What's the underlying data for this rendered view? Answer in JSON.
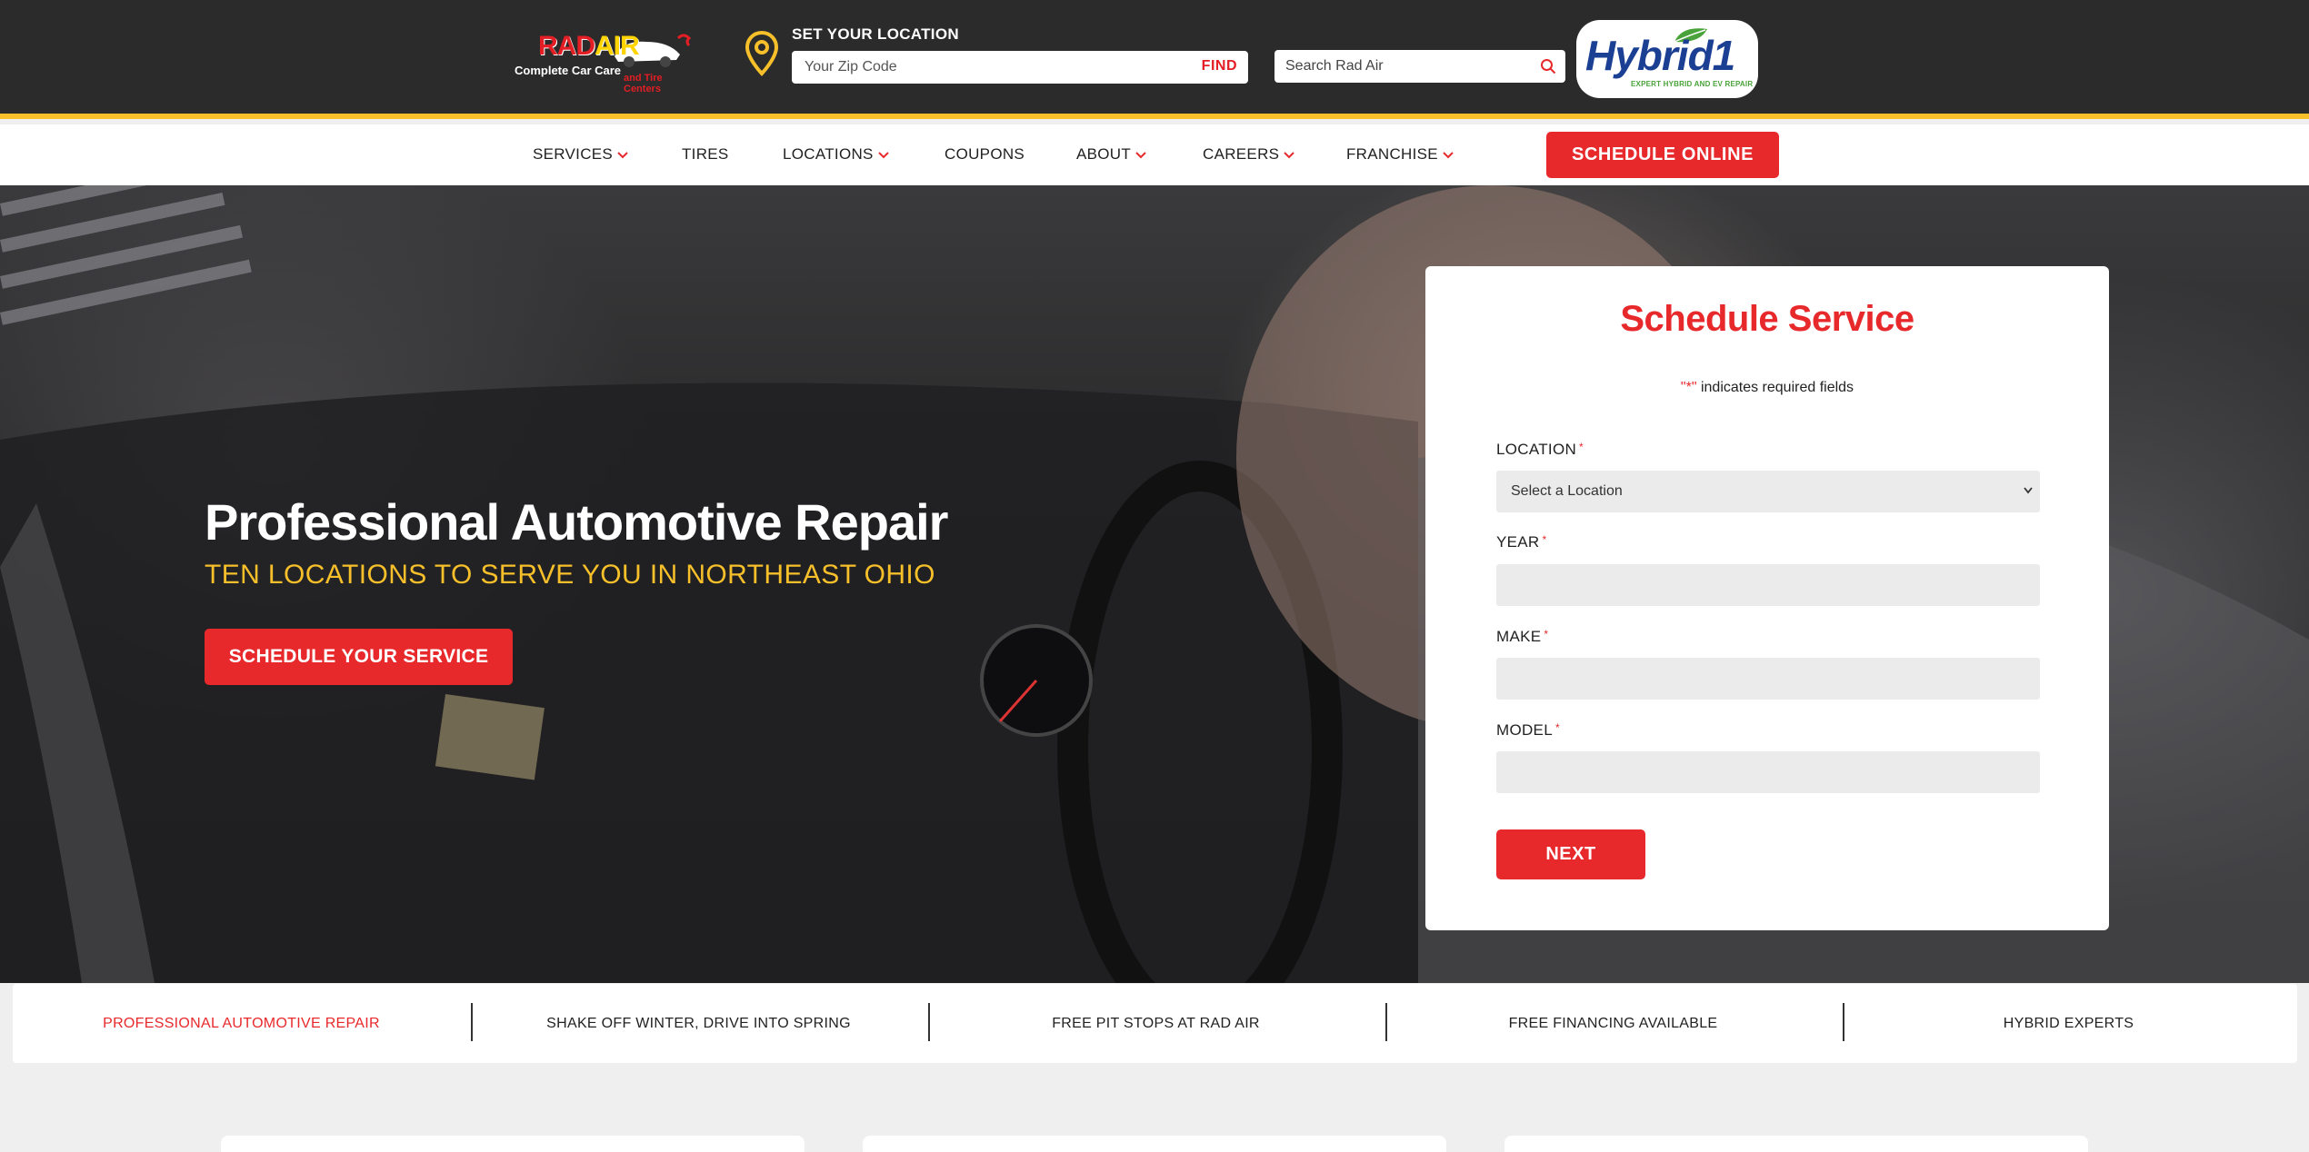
{
  "header": {
    "logo": {
      "brand_rad": "RAD",
      "brand_air": "AIR",
      "tagline_1": "Complete Car Care",
      "tagline_2": "and Tire Centers"
    },
    "location": {
      "label": "SET YOUR LOCATION",
      "zip_placeholder": "Your Zip Code",
      "find_label": "FIND",
      "icon": "map-pin-icon"
    },
    "search": {
      "placeholder": "Search Rad Air",
      "icon": "search-icon"
    },
    "hybrid_badge": {
      "title": "Hybrid1",
      "subtitle": "EXPERT HYBRID AND EV REPAIR"
    }
  },
  "nav": {
    "items": [
      {
        "label": "SERVICES",
        "dropdown": true
      },
      {
        "label": "TIRES",
        "dropdown": false
      },
      {
        "label": "LOCATIONS",
        "dropdown": true
      },
      {
        "label": "COUPONS",
        "dropdown": false
      },
      {
        "label": "ABOUT",
        "dropdown": true
      },
      {
        "label": "CAREERS",
        "dropdown": true
      },
      {
        "label": "FRANCHISE",
        "dropdown": true
      }
    ],
    "cta_label": "SCHEDULE ONLINE"
  },
  "hero": {
    "title": "Professional Automotive Repair",
    "subtitle": "TEN LOCATIONS TO SERVE YOU IN NORTHEAST OHIO",
    "button_label": "SCHEDULE YOUR SERVICE"
  },
  "schedule_form": {
    "title": "Schedule Service",
    "required_note_mark": "\"*\"",
    "required_note_text": " indicates required fields",
    "fields": {
      "location": {
        "label": "LOCATION",
        "required_mark": "*",
        "selected": "Select a Location"
      },
      "year": {
        "label": "YEAR",
        "required_mark": "*",
        "value": ""
      },
      "make": {
        "label": "MAKE",
        "required_mark": "*",
        "value": ""
      },
      "model": {
        "label": "MODEL",
        "required_mark": "*",
        "value": ""
      }
    },
    "next_label": "NEXT"
  },
  "ticker": {
    "items": [
      {
        "label": "PROFESSIONAL AUTOMOTIVE REPAIR",
        "active": true
      },
      {
        "label": "SHAKE OFF WINTER, DRIVE INTO SPRING",
        "active": false
      },
      {
        "label": "FREE PIT STOPS AT RAD AIR",
        "active": false
      },
      {
        "label": "FREE FINANCING AVAILABLE",
        "active": false
      },
      {
        "label": "HYBRID EXPERTS",
        "active": false
      }
    ]
  },
  "colors": {
    "brand_red": "#e8292c",
    "brand_yellow": "#f7c02a",
    "topbar_bg": "#2b2b2b",
    "hybrid_blue": "#1b3f93",
    "hybrid_green": "#4aa33a"
  }
}
